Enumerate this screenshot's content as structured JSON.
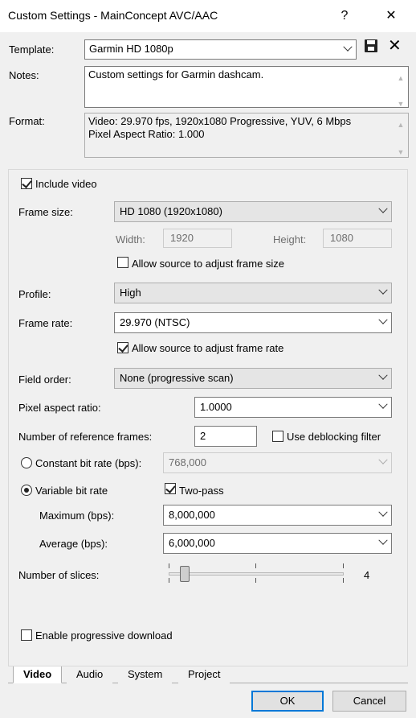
{
  "window": {
    "title": "Custom Settings - MainConcept AVC/AAC",
    "help_label": "?",
    "close_label": "✕"
  },
  "template": {
    "label": "Template:",
    "value": "Garmin HD 1080p",
    "save_icon": "save-icon",
    "delete_label": "✕"
  },
  "notes": {
    "label": "Notes:",
    "value": "Custom settings for Garmin dashcam."
  },
  "format": {
    "label": "Format:",
    "line1": "Video: 29.970 fps, 1920x1080 Progressive, YUV, 6 Mbps",
    "line2": "Pixel Aspect Ratio: 1.000"
  },
  "video": {
    "include_video": {
      "label": "Include video",
      "checked": true
    },
    "frame_size": {
      "label": "Frame size:",
      "value": "HD 1080 (1920x1080)"
    },
    "width": {
      "label": "Width:",
      "value": "1920"
    },
    "height": {
      "label": "Height:",
      "value": "1080"
    },
    "allow_frame_size": {
      "label": "Allow source to adjust frame size",
      "checked": false
    },
    "profile": {
      "label": "Profile:",
      "value": "High"
    },
    "frame_rate": {
      "label": "Frame rate:",
      "value": "29.970 (NTSC)"
    },
    "allow_frame_rate": {
      "label": "Allow source to adjust frame rate",
      "checked": true
    },
    "field_order": {
      "label": "Field order:",
      "value": "None (progressive scan)"
    },
    "pixel_aspect": {
      "label": "Pixel aspect ratio:",
      "value": "1.0000"
    },
    "ref_frames": {
      "label": "Number of reference frames:",
      "value": "2"
    },
    "deblocking": {
      "label": "Use deblocking filter",
      "checked": false
    },
    "constant_bitrate": {
      "label": "Constant bit rate (bps):",
      "value": "768,000",
      "selected": false
    },
    "variable_bitrate": {
      "label": "Variable bit rate",
      "selected": true
    },
    "two_pass": {
      "label": "Two-pass",
      "checked": true
    },
    "maximum": {
      "label": "Maximum (bps):",
      "value": "8,000,000"
    },
    "average": {
      "label": "Average (bps):",
      "value": "6,000,000"
    },
    "slices": {
      "label": "Number of slices:",
      "value": "4"
    },
    "progressive_download": {
      "label": "Enable progressive download",
      "checked": false
    }
  },
  "tabs": [
    "Video",
    "Audio",
    "System",
    "Project"
  ],
  "buttons": {
    "ok": "OK",
    "cancel": "Cancel"
  }
}
